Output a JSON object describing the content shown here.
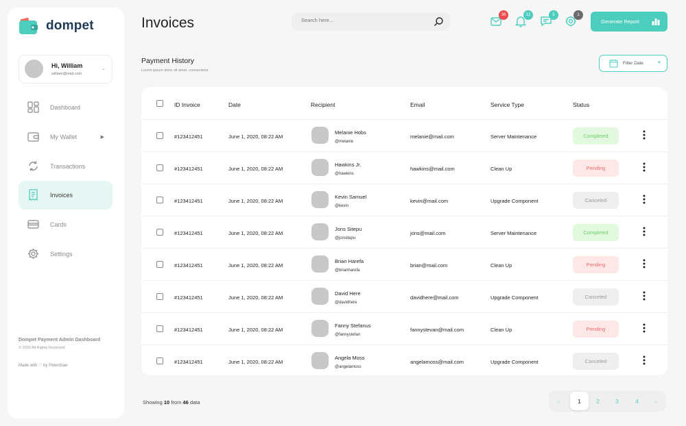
{
  "brand": {
    "name": "dompet",
    "accent": "#4dcdbd"
  },
  "user": {
    "greeting": "Hi, William",
    "email": "william@mail.com"
  },
  "nav": [
    {
      "label": "Dashboard",
      "icon": "dashboard-icon",
      "active": false
    },
    {
      "label": "My Wallet",
      "icon": "wallet-icon",
      "active": false,
      "has_submenu": true
    },
    {
      "label": "Transactions",
      "icon": "refresh-icon",
      "active": false
    },
    {
      "label": "Invoices",
      "icon": "receipt-icon",
      "active": true
    },
    {
      "label": "Cards",
      "icon": "card-icon",
      "active": false
    },
    {
      "label": "Settings",
      "icon": "gear-icon",
      "active": false
    }
  ],
  "sidebar_footer": {
    "title": "Dompet Payment Admin Dashboard",
    "copyright": "© 2020 All Rights Reserved",
    "made_with": "Made with ♡ by Peterdraw"
  },
  "header": {
    "title": "Invoices",
    "search_placeholder": "Search here...",
    "badges": {
      "mail": {
        "count": "36",
        "color": "#ef4b4b"
      },
      "bell": {
        "count": "12",
        "color": "#4dcdbd"
      },
      "chat": {
        "count": "5",
        "color": "#4dcdbd"
      },
      "settings": {
        "count": "1",
        "color": "#6b6b6b"
      }
    },
    "generate_label": "Generate Report"
  },
  "section": {
    "title": "Payment History",
    "subtitle": "Lorem ipsum dolor sit amet, consectetur",
    "filter_label": "Filter Date"
  },
  "table": {
    "columns": [
      "ID Invoice",
      "Date",
      "Recipient",
      "Email",
      "Service Type",
      "Status"
    ],
    "rows": [
      {
        "id": "#123412451",
        "date": "June 1, 2020, 08:22 AM",
        "name": "Melanie Hobs",
        "handle": "@melanie",
        "email": "melanie@mail.com",
        "service": "Server Maintenance",
        "status": "Completed"
      },
      {
        "id": "#123412451",
        "date": "June 1, 2020, 08:22 AM",
        "name": "Hawkins Jr.",
        "handle": "@hawkins",
        "email": "hawkins@mail.com",
        "service": "Clean Up",
        "status": "Pending"
      },
      {
        "id": "#123412451",
        "date": "June 1, 2020, 08:22 AM",
        "name": "Kevin Samuel",
        "handle": "@kevin",
        "email": "kevin@mail.com",
        "service": "Upgrade Component",
        "status": "Canceled"
      },
      {
        "id": "#123412451",
        "date": "June 1, 2020, 08:22 AM",
        "name": "Jons Sitepu",
        "handle": "@jonsitepu",
        "email": "jons@mail.com",
        "service": "Server Maintenance",
        "status": "Completed"
      },
      {
        "id": "#123412451",
        "date": "June 1, 2020, 08:22 AM",
        "name": "Brian Harefa",
        "handle": "@brianharefa",
        "email": "brian@mail.com",
        "service": "Clean Up",
        "status": "Pending"
      },
      {
        "id": "#123412451",
        "date": "June 1, 2020, 08:22 AM",
        "name": "David Here",
        "handle": "@davidhere",
        "email": "davidhere@mail.com",
        "service": "Upgrade Component",
        "status": "Canceled"
      },
      {
        "id": "#123412451",
        "date": "June 1, 2020, 08:22 AM",
        "name": "Fanny Stefanus",
        "handle": "@fannystefan",
        "email": "fannystevan@mail.com",
        "service": "Clean Up",
        "status": "Pending"
      },
      {
        "id": "#123412451",
        "date": "June 1, 2020, 08:22 AM",
        "name": "Angela Moss",
        "handle": "@angelamoss",
        "email": "angelamoss@mail.com",
        "service": "Upgrade Component",
        "status": "Canceled"
      }
    ]
  },
  "footer": {
    "showing_prefix": "Showing",
    "shown": "10",
    "from_word": "from",
    "total": "46",
    "suffix": "data"
  },
  "pagination": {
    "prev": "«",
    "next": "»",
    "pages": [
      "1",
      "2",
      "3",
      "4"
    ],
    "current": "1"
  }
}
